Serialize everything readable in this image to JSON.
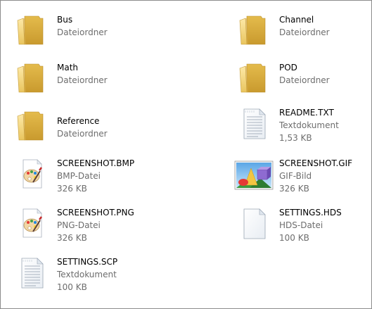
{
  "items": [
    {
      "name": "Bus",
      "type": "Dateiordner",
      "icon": "folder-icon"
    },
    {
      "name": "Channel",
      "type": "Dateiordner",
      "icon": "folder-icon"
    },
    {
      "name": "Math",
      "type": "Dateiordner",
      "icon": "folder-icon"
    },
    {
      "name": "POD",
      "type": "Dateiordner",
      "icon": "folder-icon"
    },
    {
      "name": "Reference",
      "type": "Dateiordner",
      "icon": "folder-icon"
    },
    {
      "name": "README.TXT",
      "type": "Textdokument",
      "size": "1,53 KB",
      "icon": "text-document-icon"
    },
    {
      "name": "SCREENSHOT.BMP",
      "type": "BMP-Datei",
      "size": "326 KB",
      "icon": "paint-image-icon"
    },
    {
      "name": "SCREENSHOT.GIF",
      "type": "GIF-Bild",
      "size": "326 KB",
      "icon": "picture-thumbnail-icon"
    },
    {
      "name": "SCREENSHOT.PNG",
      "type": "PNG-Datei",
      "size": "326 KB",
      "icon": "paint-image-icon"
    },
    {
      "name": "SETTINGS.HDS",
      "type": "HDS-Datei",
      "size": "100 KB",
      "icon": "blank-file-icon"
    },
    {
      "name": "SETTINGS.SCP",
      "type": "Textdokument",
      "size": "100 KB",
      "icon": "text-document-icon"
    }
  ],
  "colors": {
    "folder_back": "#e8c45a",
    "folder_front": "#f7dc8c",
    "secondary_text": "#6d6d6d"
  }
}
